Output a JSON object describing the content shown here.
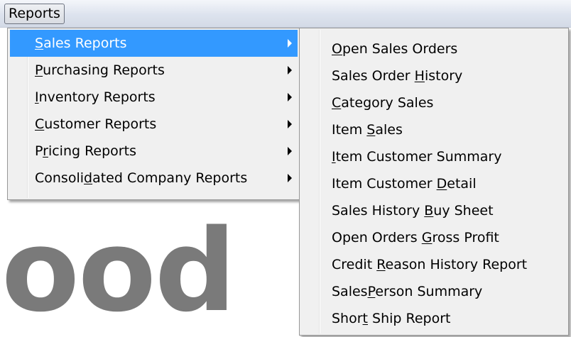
{
  "menubar": {
    "reports_label": "Reports"
  },
  "background_text": "ood",
  "colors": {
    "highlight": "#3399ff",
    "menu_bg": "#f0f0f0"
  },
  "main_menu": {
    "items": [
      {
        "pre": "",
        "acc": "S",
        "post": "ales Reports",
        "selected": true
      },
      {
        "pre": "",
        "acc": "P",
        "post": "urchasing Reports"
      },
      {
        "pre": "",
        "acc": "I",
        "post": "nventory Reports"
      },
      {
        "pre": "",
        "acc": "C",
        "post": "ustomer Reports"
      },
      {
        "pre": "P",
        "acc": "r",
        "post": "icing Reports"
      },
      {
        "pre": "Consoli",
        "acc": "d",
        "post": "ated Company Reports"
      }
    ]
  },
  "sub_menu": {
    "items": [
      {
        "pre": "",
        "acc": "O",
        "post": "pen Sales Orders"
      },
      {
        "pre": "Sales Order ",
        "acc": "H",
        "post": "istory"
      },
      {
        "pre": "",
        "acc": "C",
        "post": "ategory Sales"
      },
      {
        "pre": "Item ",
        "acc": "S",
        "post": "ales"
      },
      {
        "pre": "",
        "acc": "I",
        "post": "tem Customer Summary"
      },
      {
        "pre": "Item Customer ",
        "acc": "D",
        "post": "etail"
      },
      {
        "pre": "Sales History ",
        "acc": "B",
        "post": "uy Sheet"
      },
      {
        "pre": "Open Orders ",
        "acc": "G",
        "post": "ross Profit"
      },
      {
        "pre": "Credit ",
        "acc": "R",
        "post": "eason History Report"
      },
      {
        "pre": "Sales",
        "acc": "P",
        "post": "erson Summary"
      },
      {
        "pre": "Shor",
        "acc": "t",
        "post": " Ship Report"
      }
    ]
  }
}
